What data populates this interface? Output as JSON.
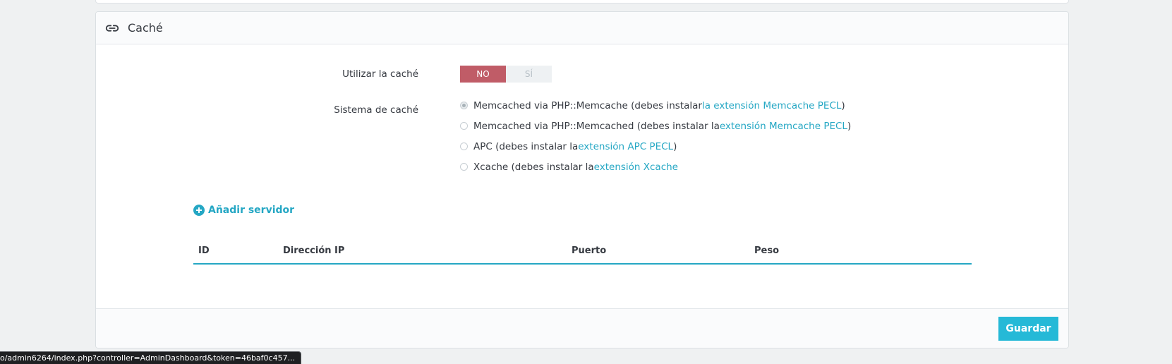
{
  "panel": {
    "title": "Caché",
    "icon": "link-icon"
  },
  "use_cache": {
    "label": "Utilizar la caché",
    "off_label": "NO",
    "on_label": "SÍ",
    "selected": "NO"
  },
  "cache_system": {
    "label": "Sistema de caché",
    "options": [
      {
        "text": "Memcached via PHP::Memcache (debes instalar ",
        "link": "la extensión Memcache PECL",
        "suffix": ")",
        "checked": true
      },
      {
        "text": "Memcached via PHP::Memcached (debes instalar la ",
        "link": "extensión Memcache PECL",
        "suffix": ")",
        "checked": false
      },
      {
        "text": "APC (debes instalar la ",
        "link": "extensión APC PECL",
        "suffix": ")",
        "checked": false
      },
      {
        "text": "Xcache (debes instalar la ",
        "link": "extensión Xcache",
        "suffix": "",
        "checked": false
      }
    ]
  },
  "servers": {
    "add_label": "Añadir servidor",
    "columns": [
      "ID",
      "Dirección IP",
      "Puerto",
      "Peso"
    ]
  },
  "footer": {
    "save_label": "Guardar"
  },
  "status_bar": {
    "url": "o/admin6264/index.php?controller=AdminDashboard&token=46baf0c457..."
  },
  "colors": {
    "accent": "#25b9d7",
    "link": "#25a7c4",
    "switch_off": "#c05c67"
  }
}
